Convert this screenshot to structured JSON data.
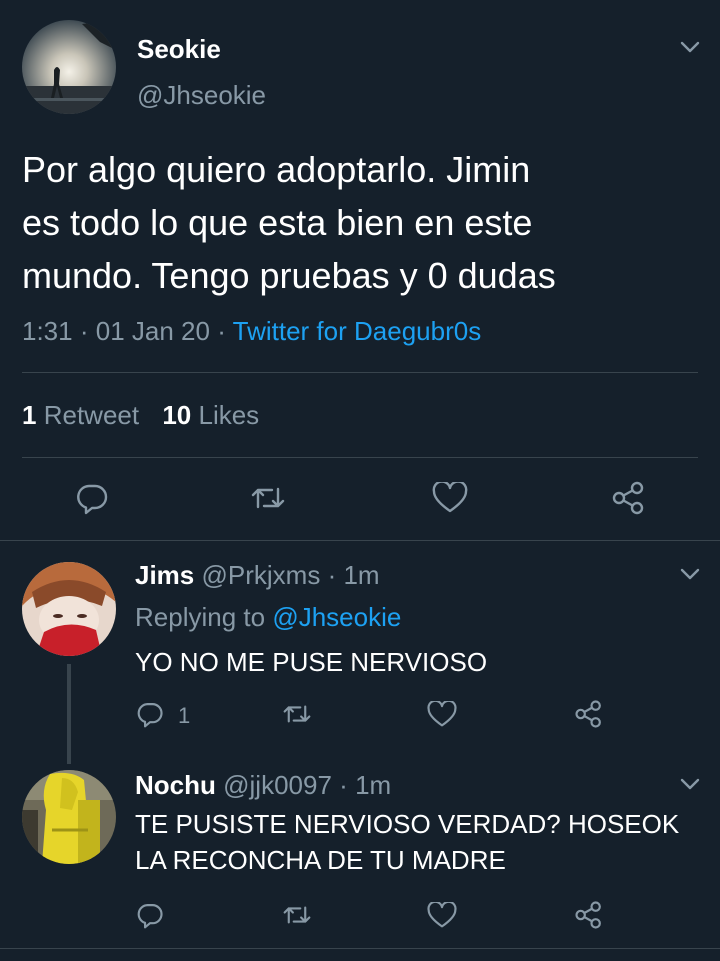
{
  "main_tweet": {
    "display_name": "Seokie",
    "handle": "@Jhseokie",
    "text_lines": [
      "Por algo quiero adoptarlo. Jimin",
      "es todo lo que esta bien en este",
      "mundo. Tengo pruebas y 0 dudas"
    ],
    "time": "1:31",
    "date": "01 Jan 20",
    "separator": "·",
    "source": "Twitter for Daegubr0s",
    "retweet_count": "1",
    "retweet_label": "Retweet",
    "like_count": "10",
    "like_label": "Likes"
  },
  "replies": [
    {
      "display_name": "Jims",
      "handle": "@Prkjxms",
      "age": "1m",
      "separator": "·",
      "replying_label": "Replying to",
      "replying_handle": "@Jhseokie",
      "text_lines": [
        "YO NO ME PUSE NERVIOSO"
      ],
      "reply_count": "1"
    },
    {
      "display_name": "Nochu",
      "handle": "@jjk0097",
      "age": "1m",
      "separator": "·",
      "text_lines": [
        "TE PUSISTE NERVIOSO VERDAD? HOSEOK",
        "LA RECONCHA DE TU MADRE"
      ]
    }
  ],
  "colors": {
    "background": "#15202b",
    "muted": "#8899a6",
    "link": "#1da1f2",
    "divider": "#38444d"
  },
  "icons": [
    "chevron-down-icon",
    "reply-icon",
    "retweet-icon",
    "like-icon",
    "share-icon"
  ]
}
